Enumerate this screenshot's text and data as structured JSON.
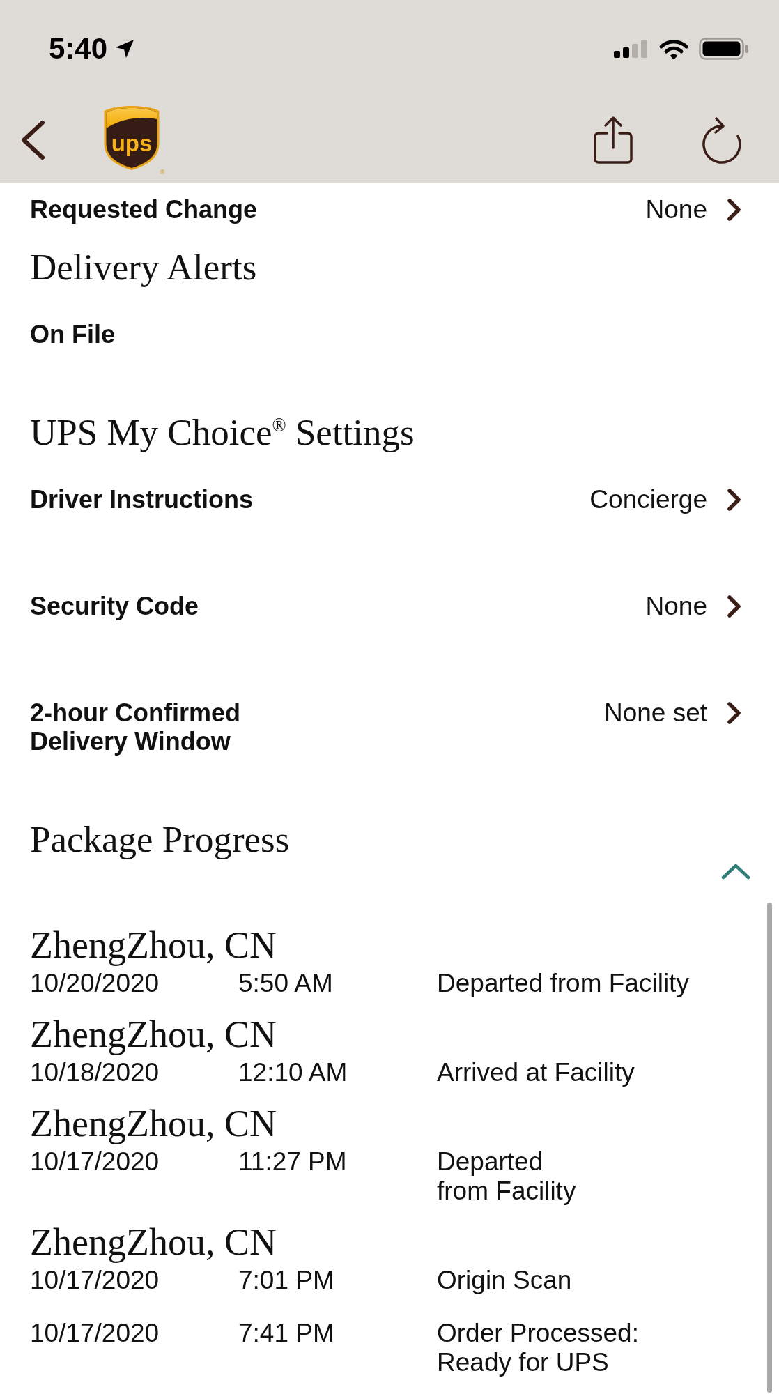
{
  "status_bar": {
    "time": "5:40"
  },
  "header": {
    "logo": {
      "text": "ups",
      "mark": "®"
    }
  },
  "sections": [
    {
      "rows": [
        {
          "kind": "link",
          "label": "Requested Change",
          "value": "None"
        }
      ]
    },
    {
      "title": "Delivery Alerts",
      "rows": [
        {
          "kind": "plain",
          "label": "On File"
        }
      ]
    },
    {
      "title": "UPS My Choice$^{®}$ Settings",
      "rows": [
        {
          "kind": "link",
          "label": "Driver Instructions",
          "value": "Concierge"
        },
        {
          "kind": "link",
          "label": "Security Code",
          "value": "None"
        },
        {
          "kind": "link",
          "label": "2-hour Confirmed Delivery Window",
          "value": "None set"
        }
      ]
    }
  ],
  "progress": {
    "title": "Package Progress",
    "expanded": true,
    "groups": [
      {
        "location": "ZhengZhou, CN",
        "events": [
          {
            "date": "10/20/2020",
            "time": "5:50 AM",
            "status": "Departed from Facility"
          }
        ]
      },
      {
        "location": "ZhengZhou, CN",
        "events": [
          {
            "date": "10/18/2020",
            "time": "12:10 AM",
            "status": "Arrived at Facility"
          }
        ]
      },
      {
        "location": "ZhengZhou, CN",
        "events": [
          {
            "date": "10/17/2020",
            "time": "11:27 PM",
            "status": "Departed\nfrom Facility"
          }
        ]
      },
      {
        "location": "ZhengZhou, CN",
        "events": [
          {
            "date": "10/17/2020",
            "time": "7:01 PM",
            "status": "Origin Scan"
          },
          {
            "date": "10/17/2020",
            "time": "7:41 PM",
            "status": "Order Processed:\nReady for UPS"
          }
        ]
      }
    ]
  }
}
